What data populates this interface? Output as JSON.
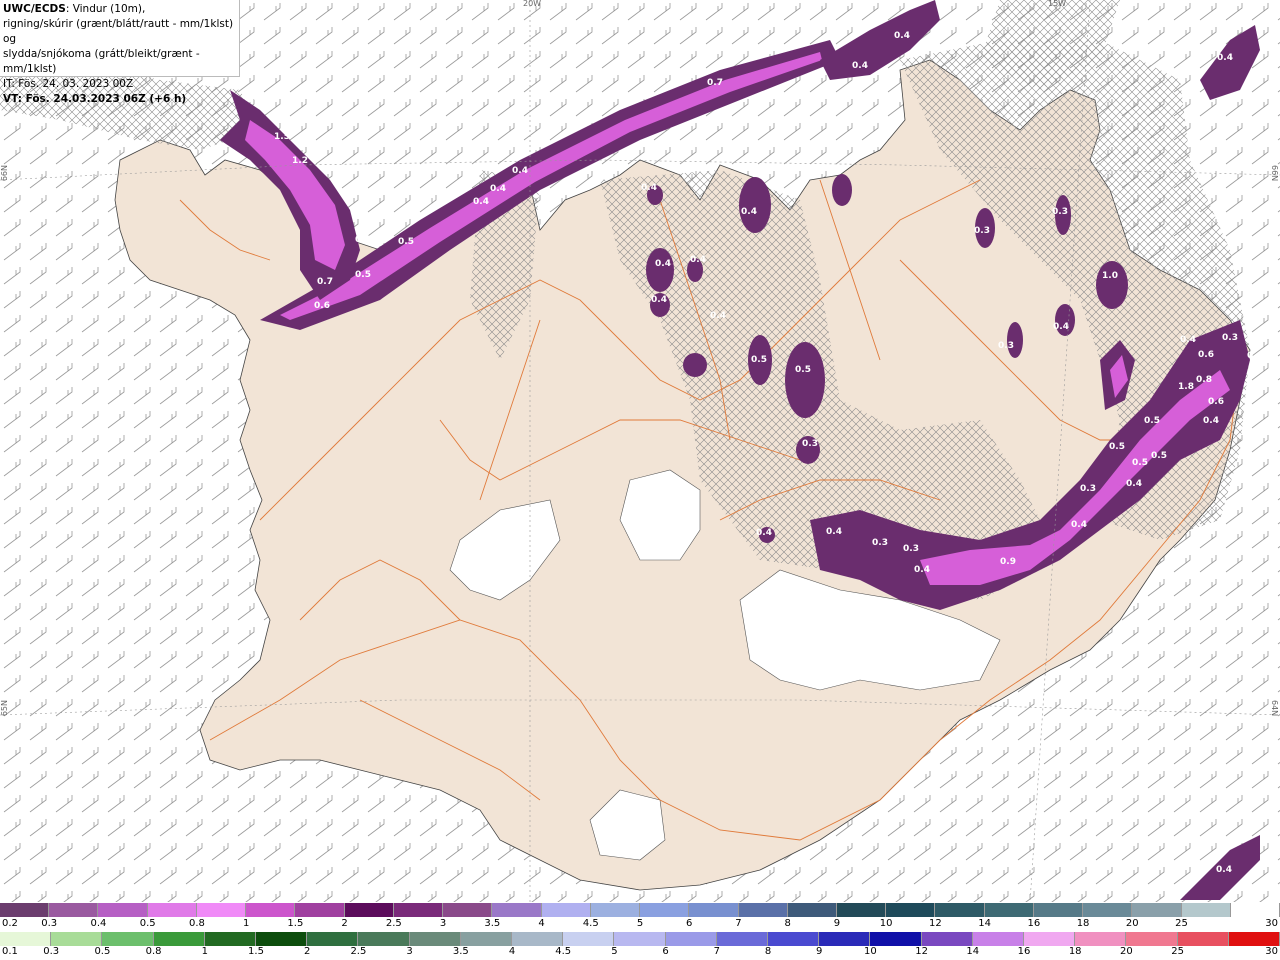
{
  "info": {
    "line1_bold": "UWC/ECDS",
    "line1_rest": ": Vindur (10m),",
    "line2": "rigning/skúrir (grænt/blátt/rautt - mm/1klst) og",
    "line3": "slydda/snjókoma (grátt/bleikt/grænt - mm/1klst)",
    "line4": "IT: Fös. 24. 03. 2023 00Z",
    "line5": "VT: Fös. 24.03.2023 06Z (+6 h)"
  },
  "grid_labels": [
    "20W",
    "15W",
    "66N",
    "66N",
    "65N",
    "64N"
  ],
  "colors": {
    "land": "#f2e4d6",
    "sea": "#ffffff",
    "roads": "#e07a3a",
    "precip_dark": "#6a2d6e",
    "precip_mid": "#9b4fa3",
    "precip_light": "#d65fd8",
    "precip_bright": "#f07cf2"
  },
  "precip_labels": [
    "0.4",
    "0.7",
    "0.4",
    "0.4",
    "0.4",
    "1.5",
    "1.2",
    "0.5",
    "0.6",
    "0.5",
    "0.6",
    "0.7",
    "0.4",
    "0.4",
    "0.4",
    "0.4",
    "0.4",
    "0.4",
    "0.4",
    "0.4",
    "0.4",
    "0.5",
    "0.5",
    "0.3",
    "0.3",
    "1.0",
    "0.3",
    "0.4",
    "0.3",
    "0.4",
    "0.6",
    "0.3",
    "0.4",
    "0.4",
    "0.3",
    "0.9",
    "0.4",
    "0.3",
    "0.4",
    "0.5",
    "0.5",
    "0.5",
    "0.4",
    "0.5",
    "0.8",
    "1.8",
    "0.6",
    "0.4",
    "0.3",
    "0.4",
    "0.4"
  ],
  "legend_snow": {
    "ticks": [
      "0.2",
      "0.3",
      "0.4",
      "0.5",
      "0.8",
      "1",
      "1.5",
      "2",
      "2.5",
      "3",
      "3.5",
      "4",
      "4.5",
      "5",
      "6",
      "7",
      "8",
      "9",
      "10",
      "12",
      "14",
      "16",
      "18",
      "20",
      "25",
      "30"
    ],
    "colors": [
      "#6b3d6e",
      "#9a5aa0",
      "#b65fc4",
      "#e07ae8",
      "#f08af7",
      "#cc55cc",
      "#a040a0",
      "#5c0c5c",
      "#7a2a7a",
      "#8a4a8a",
      "#9a78c8",
      "#b0b0f0",
      "#9cb0e0",
      "#8aa0e0",
      "#7890d0",
      "#5a70a8",
      "#3e5a7a",
      "#224a58",
      "#1e4a5a",
      "#2e5a66",
      "#3e6a74",
      "#567a88",
      "#6a8a98",
      "#8aa0aa",
      "#b4c8cc",
      "#ffffff"
    ]
  },
  "legend_rain": {
    "ticks": [
      "0.1",
      "0.3",
      "0.5",
      "0.8",
      "1",
      "1.5",
      "2",
      "2.5",
      "3",
      "3.5",
      "4",
      "4.5",
      "5",
      "6",
      "7",
      "8",
      "9",
      "10",
      "12",
      "14",
      "16",
      "18",
      "20",
      "25",
      "30"
    ],
    "colors": [
      "#e6f7d8",
      "#a8dc98",
      "#6cbf6c",
      "#3a9a3a",
      "#226a22",
      "#0d4d0d",
      "#2f6f3f",
      "#4a7a5a",
      "#6a8a7a",
      "#88a0a0",
      "#a8b8c8",
      "#c8d0f0",
      "#b8b8f0",
      "#9a9ae8",
      "#6a6ad8",
      "#4a4ad0",
      "#2a2ab8",
      "#1010a8",
      "#7a48c0",
      "#c880e8",
      "#f0a8f0",
      "#f090c0",
      "#f07890",
      "#e85060",
      "#e01010"
    ]
  }
}
